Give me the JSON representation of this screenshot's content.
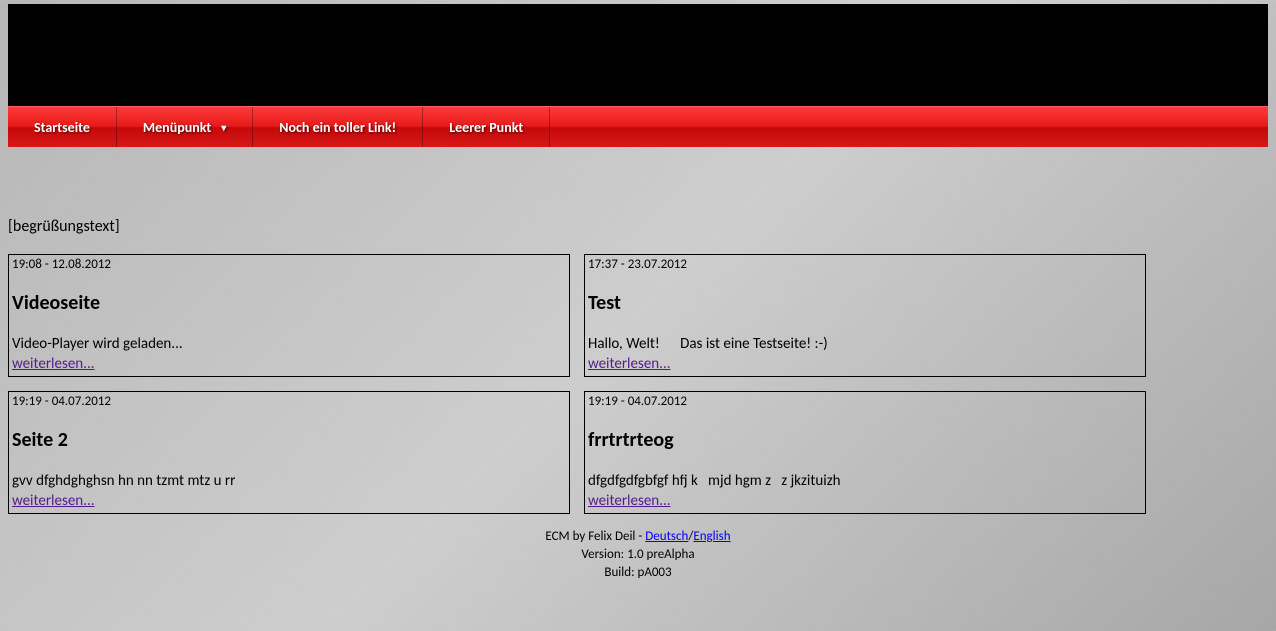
{
  "nav": {
    "items": [
      {
        "label": "Startseite",
        "hasDropdown": false,
        "hasDot": true
      },
      {
        "label": "Menüpunkt",
        "hasDropdown": true,
        "hasDot": false
      },
      {
        "label": "Noch ein toller Link!",
        "hasDropdown": false,
        "hasDot": true
      },
      {
        "label": "Leerer Punkt",
        "hasDropdown": false,
        "hasDot": false
      }
    ]
  },
  "greeting": "[begrüßungstext]",
  "cards": [
    {
      "timestamp": "19:08 - 12.08.2012",
      "title": "Videoseite",
      "body": "Video-Player wird geladen...",
      "link": "weiterlesen..."
    },
    {
      "timestamp": "17:37 - 23.07.2012",
      "title": "Test",
      "body": "Hallo, Welt!      Das ist eine Testseite! :-)",
      "link": "weiterlesen..."
    },
    {
      "timestamp": "19:19 - 04.07.2012",
      "title": "Seite 2",
      "body": "gvv dfghdghghsn hn nn tzmt mtz u rr",
      "link": "weiterlesen..."
    },
    {
      "timestamp": "19:19 - 04.07.2012",
      "title": "frrtrtrteog",
      "body": "dfgdfgdfgbfgf hfj k   mjd hgm z   z jkzituizh",
      "link": "weiterlesen..."
    }
  ],
  "footer": {
    "credits_prefix": "ECM by Felix Deil - ",
    "lang1": "Deutsch",
    "sep": "/",
    "lang2": "English",
    "version": "Version: 1.0 preAlpha",
    "build": "Build: pA003"
  }
}
